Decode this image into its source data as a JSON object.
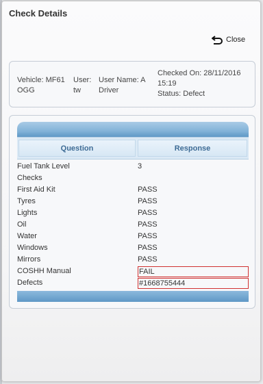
{
  "modal": {
    "title": "Check Details",
    "close_label": "Close"
  },
  "info": {
    "vehicle": "Vehicle: MF61 OGG",
    "user": "User: tw",
    "user_name": "User Name: A Driver",
    "checked_on": "Checked On: 28/11/2016 15:19",
    "status": "Status: Defect"
  },
  "table": {
    "headers": {
      "question": "Question",
      "response": "Response"
    },
    "rows": [
      {
        "question": "Fuel Tank Level",
        "response": "3"
      },
      {
        "question": "Checks",
        "response": ""
      },
      {
        "question": "First Aid Kit",
        "response": "PASS"
      },
      {
        "question": "Tyres",
        "response": "PASS"
      },
      {
        "question": "Lights",
        "response": "PASS"
      },
      {
        "question": "Oil",
        "response": "PASS"
      },
      {
        "question": "Water",
        "response": "PASS"
      },
      {
        "question": "Windows",
        "response": "PASS"
      },
      {
        "question": "Mirrors",
        "response": "PASS"
      },
      {
        "question": "COSHH Manual",
        "response": "FAIL"
      },
      {
        "question": "Defects",
        "response": "#1668755444"
      }
    ]
  },
  "colors": {
    "header_band": "#6aa3cf",
    "header_text": "#3d6b95",
    "flag_border": "#d03030"
  }
}
